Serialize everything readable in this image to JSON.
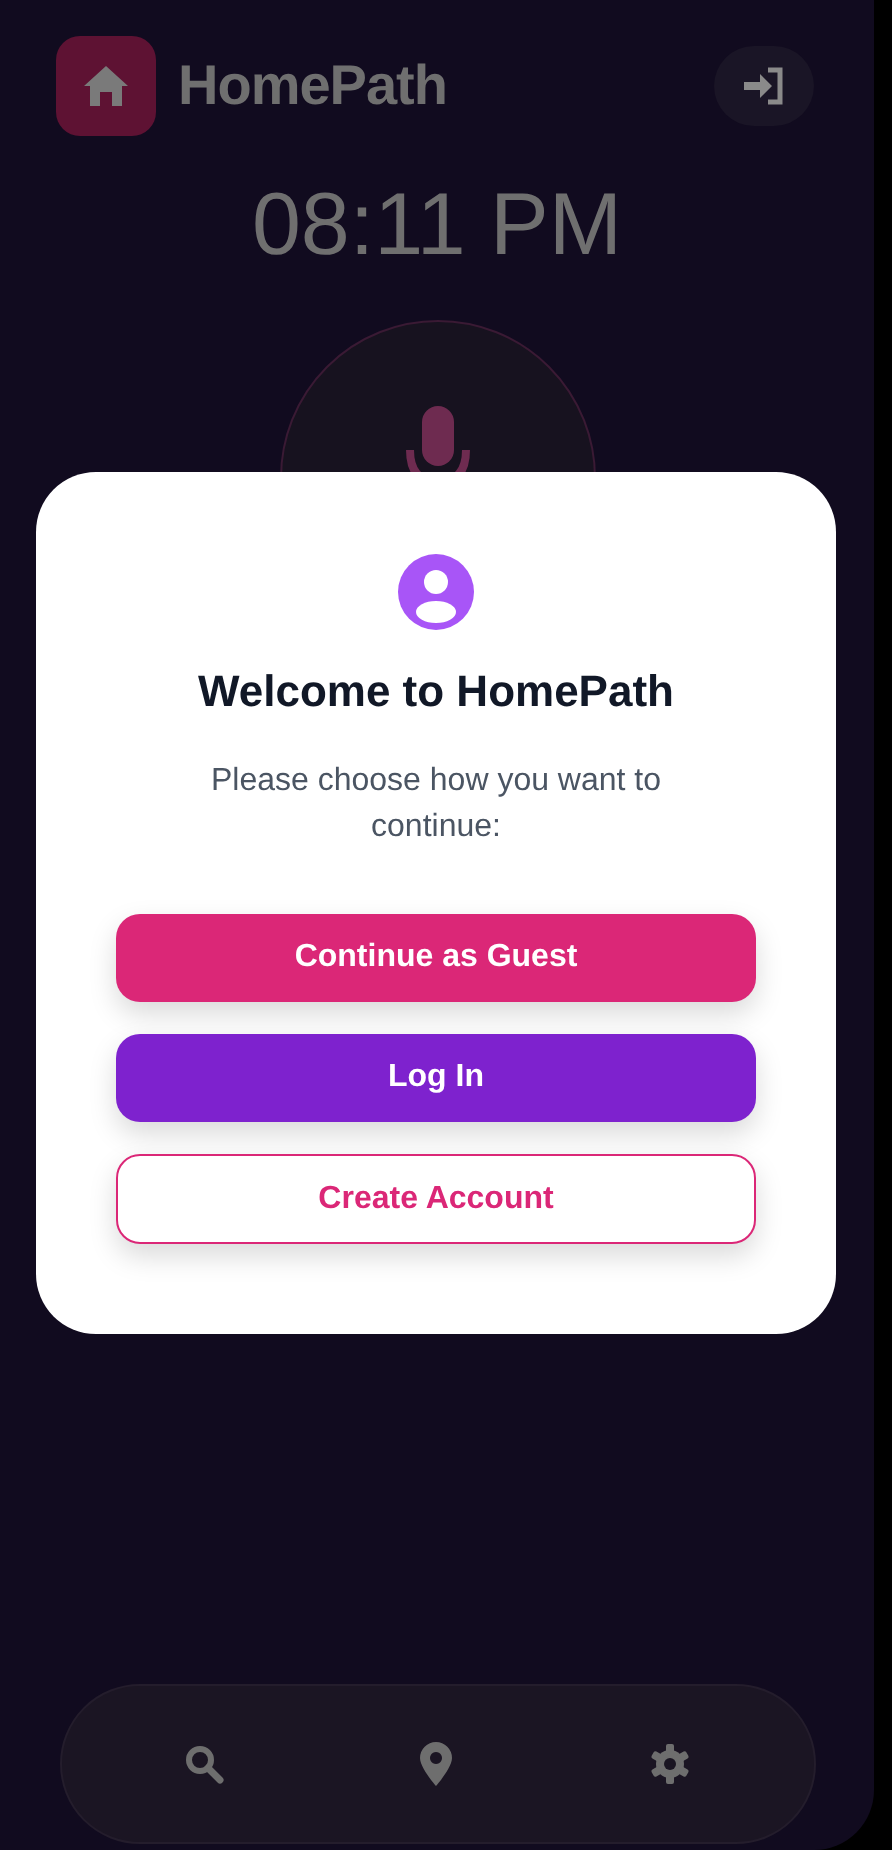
{
  "header": {
    "title": "HomePath"
  },
  "clock": {
    "time": "08:11 PM"
  },
  "dialog": {
    "title": "Welcome to HomePath",
    "message": "Please choose how you want to continue:",
    "buttons": [
      {
        "label": "Continue as Guest",
        "kind": "primary"
      },
      {
        "label": "Log In",
        "kind": "secondary"
      },
      {
        "label": "Create Account",
        "kind": "outline"
      }
    ]
  }
}
